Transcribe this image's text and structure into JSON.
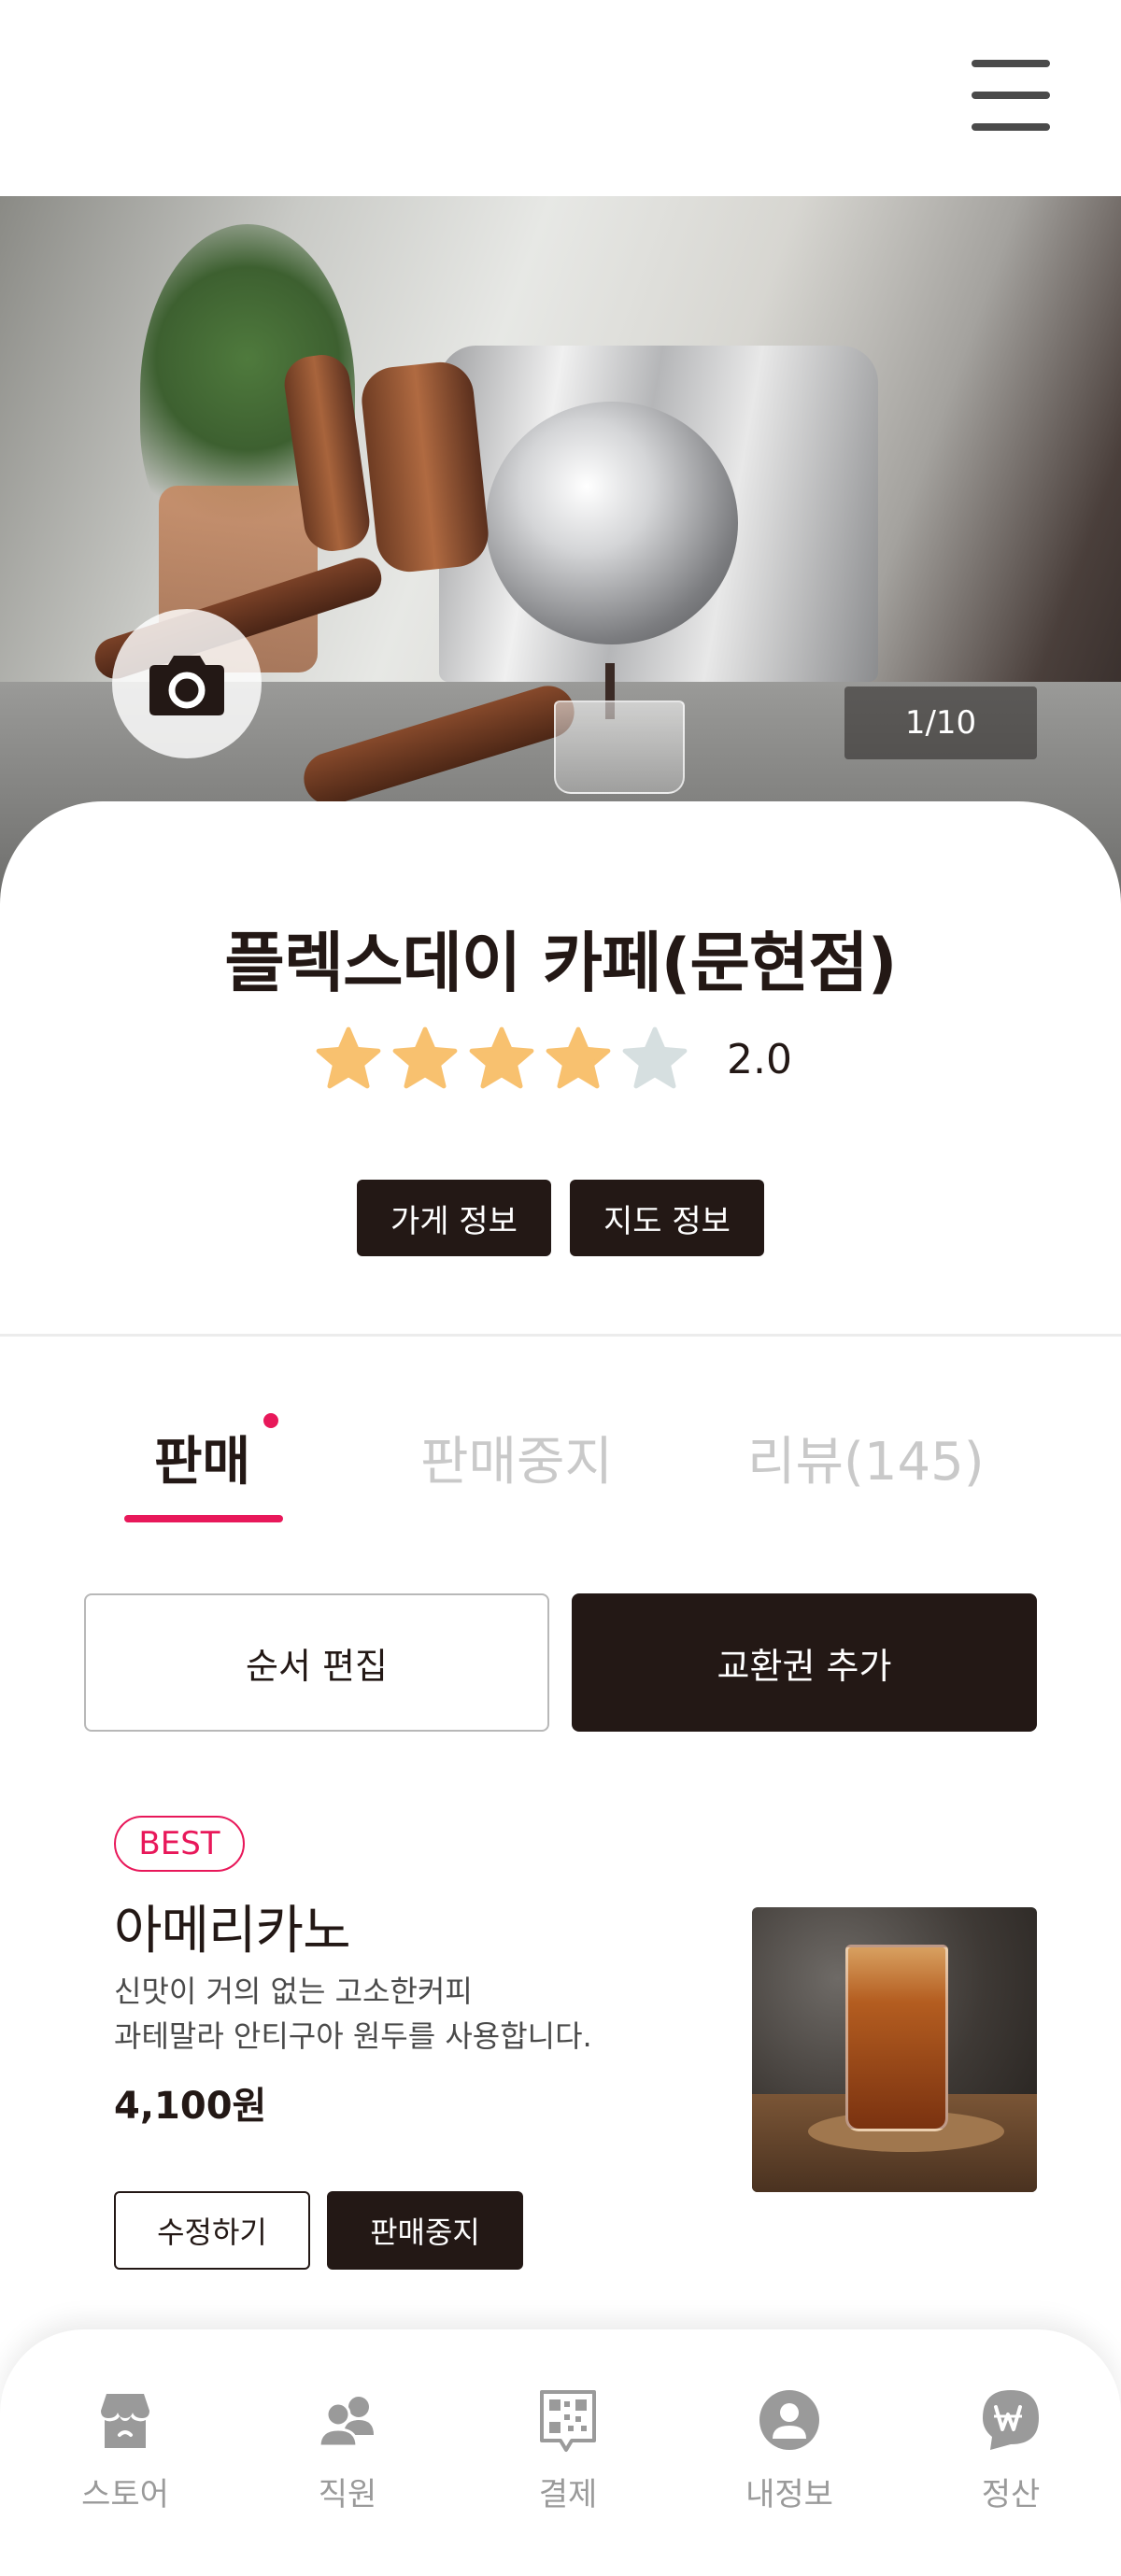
{
  "hero": {
    "image_counter": "1/10"
  },
  "store": {
    "title": "플렉스데이 카페(문현점)",
    "rating": 2.0,
    "rating_label": "2.0",
    "stars_filled": 4,
    "stars_total": 5
  },
  "info_buttons": {
    "store_info": "가게 정보",
    "map_info": "지도 정보"
  },
  "tabs": [
    {
      "label": "판매",
      "active": true,
      "has_dot": true
    },
    {
      "label": "판매중지",
      "active": false
    },
    {
      "label": "리뷰(145)",
      "active": false
    }
  ],
  "actions": {
    "edit_order": "순서 편집",
    "add_voucher": "교환권 추가"
  },
  "menu_item": {
    "badge": "BEST",
    "name": "아메리카노",
    "desc_line1": "신맛이 거의 없는 고소한커피",
    "desc_line2": "과테말라 안티구아 원두를 사용합니다.",
    "price": "4,100원",
    "edit_label": "수정하기",
    "stop_label": "판매중지"
  },
  "bottom_nav": [
    {
      "label": "스토어",
      "icon": "store-icon"
    },
    {
      "label": "직원",
      "icon": "staff-icon"
    },
    {
      "label": "결제",
      "icon": "qr-payment-icon"
    },
    {
      "label": "내정보",
      "icon": "profile-icon"
    },
    {
      "label": "정산",
      "icon": "won-settlement-icon"
    }
  ],
  "colors": {
    "primary": "#231815",
    "accent": "#e8185a",
    "star_filled": "#f8c16f",
    "star_empty": "#d6dfe0",
    "nav_icon": "#9a9a9a"
  }
}
